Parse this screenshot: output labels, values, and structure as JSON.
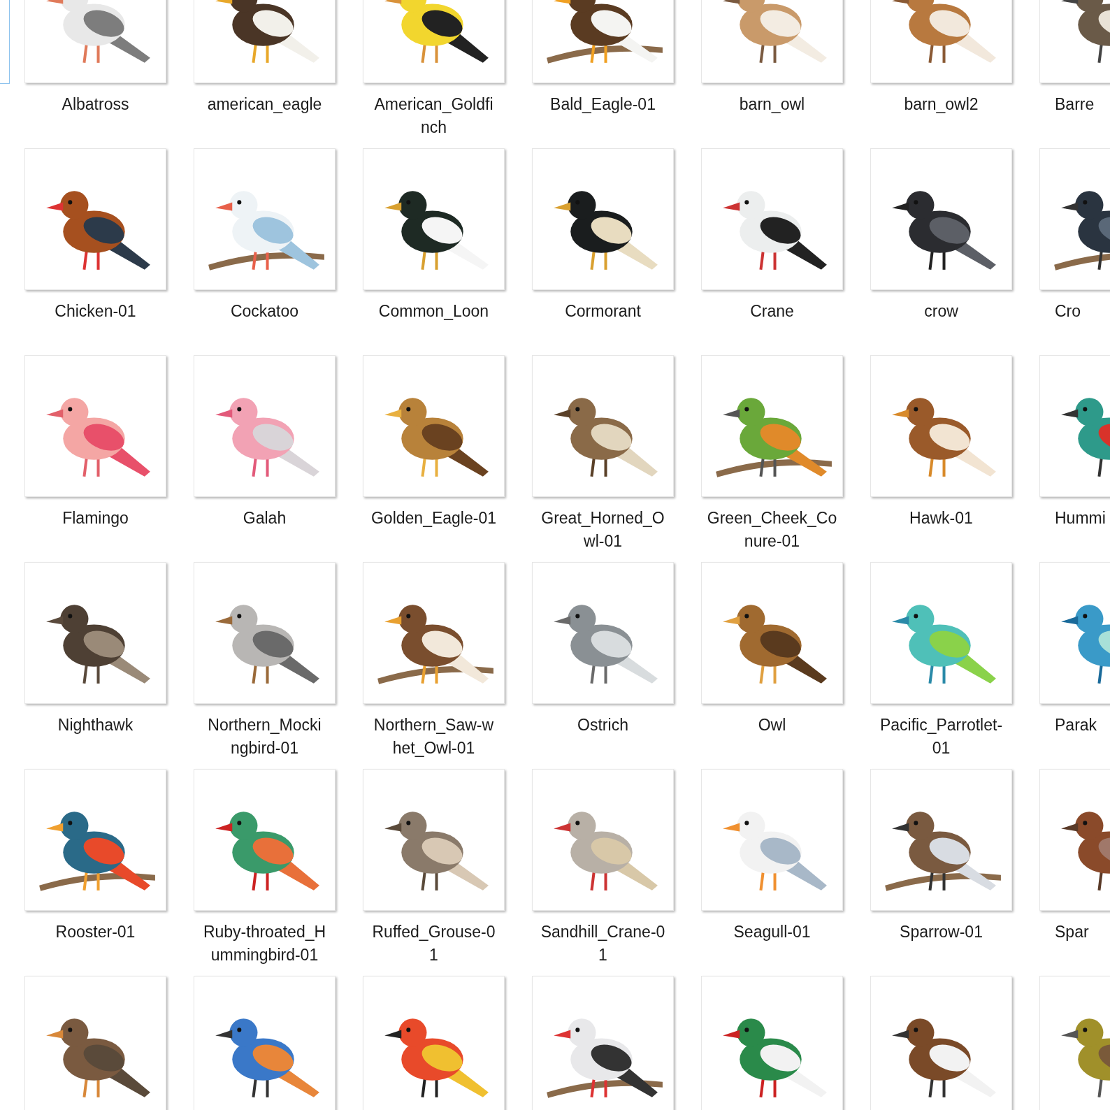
{
  "left_edge_item": {
    "selected": true
  },
  "files": [
    {
      "kind": "picture",
      "name_lines": [
        "Albatross"
      ]
    },
    {
      "kind": "picture",
      "name_lines": [
        "american_eagle"
      ]
    },
    {
      "kind": "picture",
      "name_lines": [
        "American_Goldfi",
        "nch"
      ]
    },
    {
      "kind": "picture",
      "name_lines": [
        "Bald_Eagle-01"
      ]
    },
    {
      "kind": "picture",
      "name_lines": [
        "barn_owl"
      ]
    },
    {
      "kind": "picture",
      "name_lines": [
        "barn_owl2"
      ]
    },
    {
      "kind": "picture",
      "name_lines": [
        "Barre"
      ]
    },
    {
      "kind": "picture",
      "name_lines": [
        "Chicken-01"
      ]
    },
    {
      "kind": "picture",
      "name_lines": [
        "Cockatoo"
      ]
    },
    {
      "kind": "picture",
      "name_lines": [
        "Common_Loon"
      ]
    },
    {
      "kind": "picture",
      "name_lines": [
        "Cormorant"
      ]
    },
    {
      "kind": "picture",
      "name_lines": [
        "Crane"
      ]
    },
    {
      "kind": "picture",
      "name_lines": [
        "crow"
      ]
    },
    {
      "kind": "picture",
      "name_lines": [
        "Cro"
      ]
    },
    {
      "kind": "picture",
      "name_lines": [
        "Flamingo"
      ]
    },
    {
      "kind": "picture",
      "name_lines": [
        "Galah"
      ]
    },
    {
      "kind": "picture",
      "name_lines": [
        "Golden_Eagle-01"
      ]
    },
    {
      "kind": "picture",
      "name_lines": [
        "Great_Horned_O",
        "wl-01"
      ]
    },
    {
      "kind": "picture",
      "name_lines": [
        "Green_Cheek_Co",
        "nure-01"
      ]
    },
    {
      "kind": "picture",
      "name_lines": [
        "Hawk-01"
      ]
    },
    {
      "kind": "picture",
      "name_lines": [
        "Hummi"
      ]
    },
    {
      "kind": "picture",
      "name_lines": [
        "Nighthawk"
      ]
    },
    {
      "kind": "picture",
      "name_lines": [
        "Northern_Mocki",
        "ngbird-01"
      ]
    },
    {
      "kind": "picture",
      "name_lines": [
        "Northern_Saw-w",
        "het_Owl-01"
      ]
    },
    {
      "kind": "picture",
      "name_lines": [
        "Ostrich"
      ]
    },
    {
      "kind": "picture",
      "name_lines": [
        "Owl"
      ]
    },
    {
      "kind": "picture",
      "name_lines": [
        "Pacific_Parrotlet-",
        "01"
      ]
    },
    {
      "kind": "picture",
      "name_lines": [
        "Parak"
      ]
    },
    {
      "kind": "picture",
      "name_lines": [
        "Rooster-01"
      ]
    },
    {
      "kind": "picture",
      "name_lines": [
        "Ruby-throated_H",
        "ummingbird-01"
      ]
    },
    {
      "kind": "picture",
      "name_lines": [
        "Ruffed_Grouse-0",
        "1"
      ]
    },
    {
      "kind": "picture",
      "name_lines": [
        "Sandhill_Crane-0",
        "1"
      ]
    },
    {
      "kind": "picture",
      "name_lines": [
        "Seagull-01"
      ]
    },
    {
      "kind": "picture",
      "name_lines": [
        "Sparrow-01"
      ]
    },
    {
      "kind": "picture",
      "name_lines": [
        "Spar"
      ]
    },
    {
      "kind": "picture"
    },
    {
      "kind": "picture"
    },
    {
      "kind": "picture"
    },
    {
      "kind": "picture"
    },
    {
      "kind": "picture"
    },
    {
      "kind": "picture"
    },
    {
      "kind": "picture"
    }
  ]
}
